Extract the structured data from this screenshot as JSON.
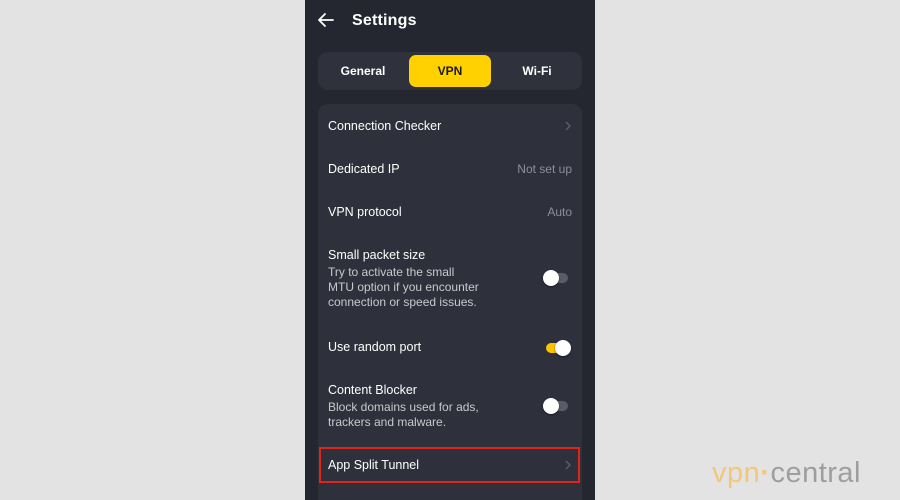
{
  "header": {
    "title": "Settings"
  },
  "tabs": [
    {
      "label": "General"
    },
    {
      "label": "VPN"
    },
    {
      "label": "Wi-Fi"
    }
  ],
  "settings": {
    "connection_checker": {
      "label": "Connection Checker"
    },
    "dedicated_ip": {
      "label": "Dedicated IP",
      "value": "Not set up"
    },
    "vpn_protocol": {
      "label": "VPN protocol",
      "value": "Auto"
    },
    "small_packet": {
      "label": "Small packet size",
      "desc1": "Try to activate the small",
      "desc2": "MTU option if you encounter",
      "desc3": "connection or speed issues.",
      "enabled": false
    },
    "random_port": {
      "label": "Use random port",
      "enabled": true
    },
    "content_blocker": {
      "label": "Content Blocker",
      "desc1": "Block domains used for ads,",
      "desc2": "trackers and malware.",
      "enabled": false
    },
    "split_tunnel": {
      "label": "App Split Tunnel"
    }
  },
  "watermark": {
    "part1": "vpn",
    "part2": "central"
  },
  "colors": {
    "accent": "#ffd100",
    "background": "#242730",
    "card": "#2e313b",
    "highlight_border": "#e2231a"
  }
}
